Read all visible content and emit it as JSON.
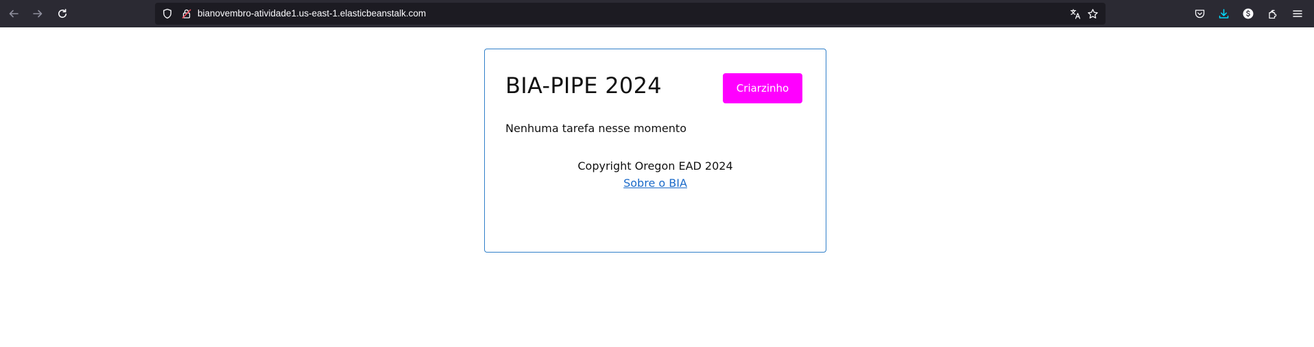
{
  "browser": {
    "url": "bianovembro-atividade1.us-east-1.elasticbeanstalk.com",
    "icons": {
      "back": "arrow-left-icon",
      "forward": "arrow-right-icon",
      "reload": "reload-icon",
      "tracking": "shield-icon",
      "security": "lock-icon",
      "translate": "translate-icon",
      "bookmark": "star-icon",
      "pocket": "pocket-icon",
      "downloads": "download-icon",
      "account": "account-icon",
      "extensions": "extensions-icon",
      "menu": "hamburger-menu-icon"
    },
    "download_color": "#00ddff"
  },
  "page": {
    "title": "BIA-PIPE 2024",
    "create_button_label": "Criarzinho",
    "empty_message": "Nenhuma tarefa nesse momento",
    "footer": {
      "copyright": "Copyright Oregon EAD 2024",
      "about_link": "Sobre o BIA"
    },
    "accent_color": "#ff00ff",
    "border_color": "#2f7fc9"
  }
}
